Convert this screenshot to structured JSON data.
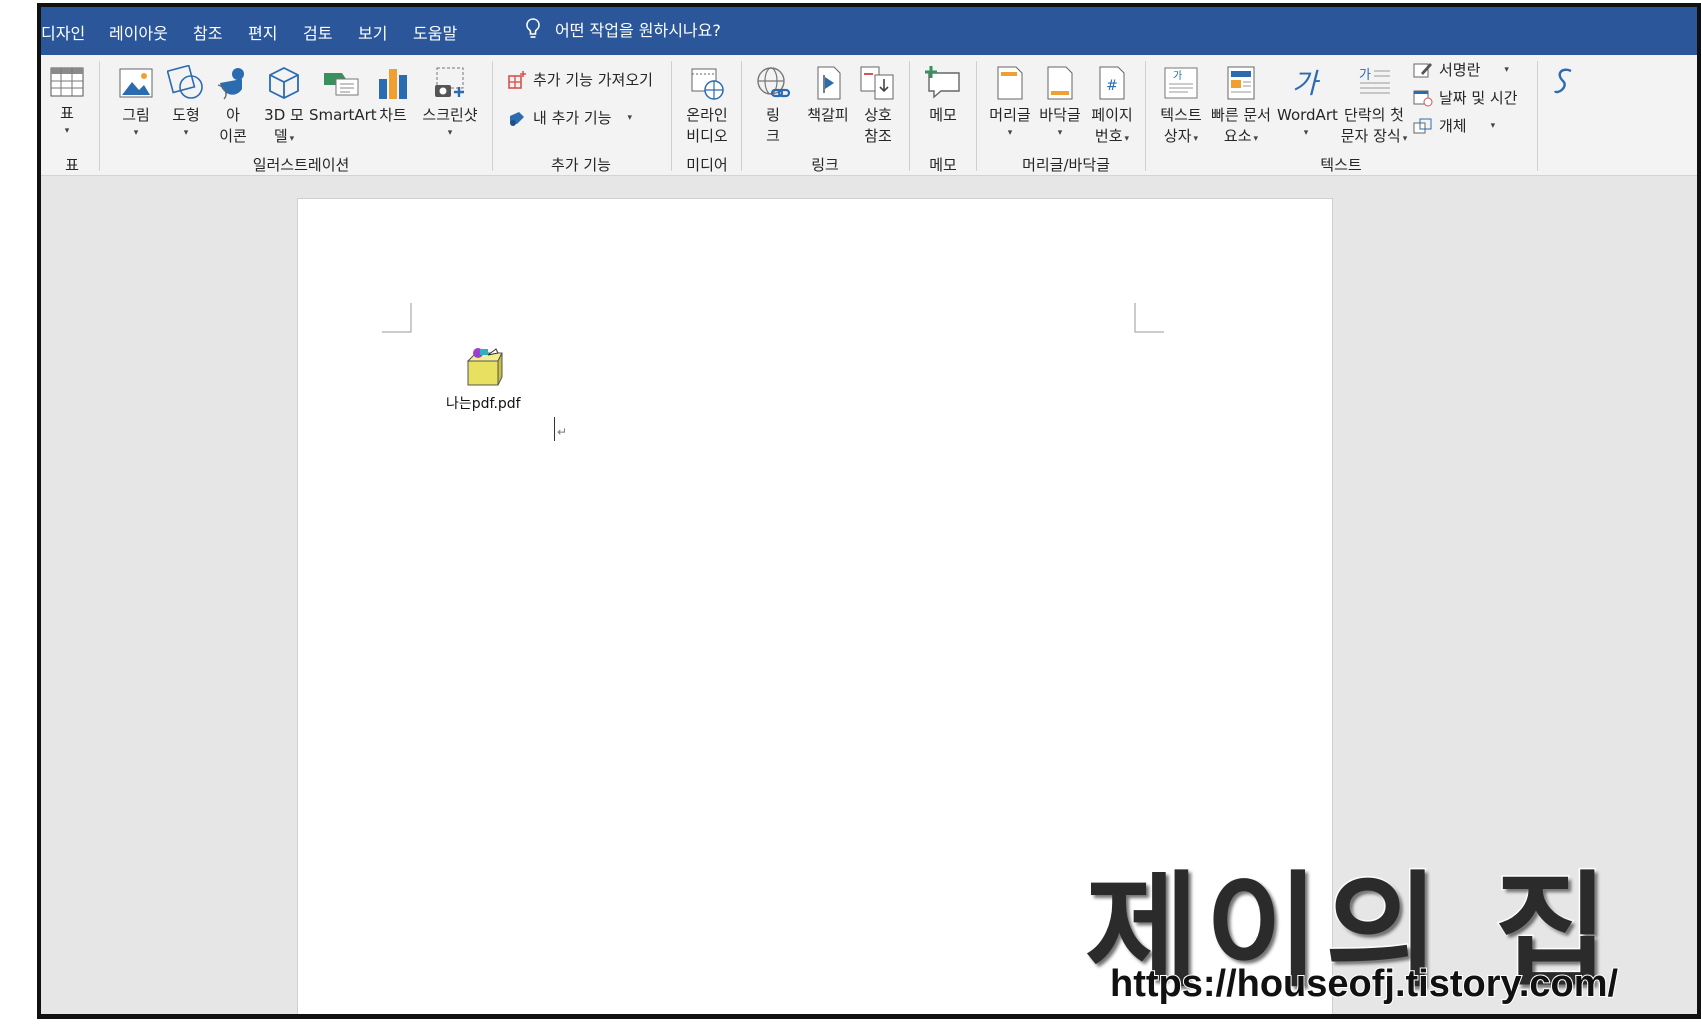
{
  "menu": {
    "tabs": [
      "디자인",
      "레이아웃",
      "참조",
      "편지",
      "검토",
      "보기",
      "도움말"
    ],
    "tell_me": "어떤 작업을 원하시나요?"
  },
  "ribbon": {
    "table": {
      "label": "표",
      "group": "표"
    },
    "illustrations": {
      "group": "일러스트레이션",
      "picture": "그림",
      "shapes": "도형",
      "icons_line1": "아",
      "icons_line2": "이콘",
      "model3d_line1": "3D 모",
      "model3d_line2": "델",
      "smartart": "SmartArt",
      "chart": "차트",
      "screenshot": "스크린샷"
    },
    "addins": {
      "group": "추가 기능",
      "get": "추가 기능 가져오기",
      "my": "내 추가 기능"
    },
    "media": {
      "group": "미디어",
      "online_video_line1": "온라인",
      "online_video_line2": "비디오"
    },
    "links": {
      "group": "링크",
      "link_line1": "링",
      "link_line2": "크",
      "bookmark": "책갈피",
      "crossref_line1": "상호",
      "crossref_line2": "참조"
    },
    "comments": {
      "group": "메모",
      "comment": "메모"
    },
    "header_footer": {
      "group": "머리글/바닥글",
      "header": "머리글",
      "footer": "바닥글",
      "page_number_line1": "페이지",
      "page_number_line2": "번호"
    },
    "text": {
      "group": "텍스트",
      "textbox_line1": "텍스트",
      "textbox_line2": "상자",
      "quickparts_line1": "빠른 문서",
      "quickparts_line2": "요소",
      "wordart": "WordArt",
      "dropcap_line1": "단락의 첫",
      "dropcap_line2": "문자 장식",
      "signature": "서명란",
      "datetime": "날짜 및 시간",
      "object": "개체"
    }
  },
  "document": {
    "attachment_name": "나는pdf.pdf",
    "paragraph_mark": "↵"
  },
  "watermark": {
    "title": "제이의 집",
    "url": "https://houseofj.tistory.com/"
  },
  "colors": {
    "menubar": "#2b579a",
    "accent_blue": "#2b6cb0",
    "accent_red": "#d9534f"
  }
}
